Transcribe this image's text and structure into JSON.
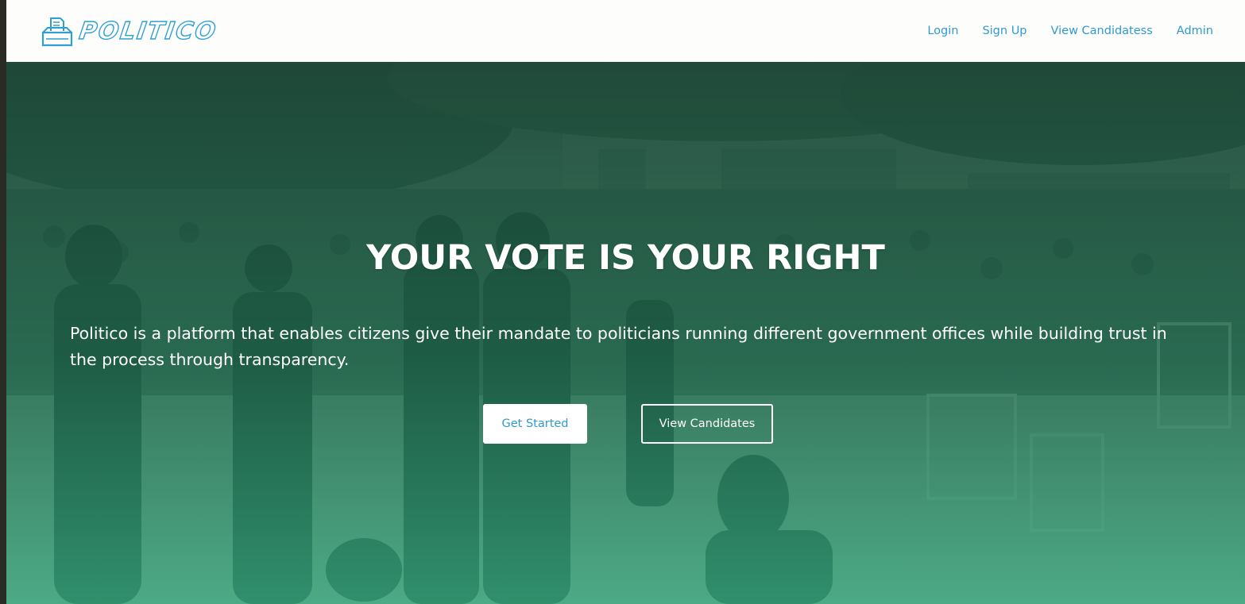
{
  "brand": {
    "name": "POLITICO",
    "logo_icon": "ballot-box-icon",
    "color": "#2f9fd3"
  },
  "nav": {
    "items": [
      {
        "label": "Login"
      },
      {
        "label": "Sign Up"
      },
      {
        "label": "View Candidatess"
      },
      {
        "label": "Admin"
      }
    ]
  },
  "hero": {
    "headline": "YOUR VOTE IS YOUR RIGHT",
    "tagline": "Politico is a platform that enables citizens give their mandate to politicians running different government offices while building trust in the process through transparency.",
    "primary_button": "Get Started",
    "secondary_button": "View Candidates",
    "overlay_color_top": "#1b4a3a",
    "overlay_color_bottom": "#33a27a"
  }
}
